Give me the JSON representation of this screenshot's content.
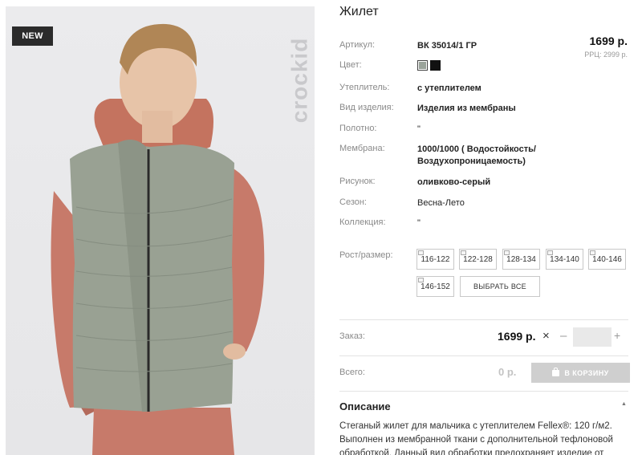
{
  "photo": {
    "badge": "NEW",
    "brand_watermark": "crockid"
  },
  "product": {
    "title": "Жилет",
    "price": "1699 р.",
    "rrp": "РРЦ: 2999 р."
  },
  "attributes": [
    {
      "label": "Артикул:",
      "value": "ВК 35014/1 ГР"
    },
    {
      "label": "Цвет:",
      "value": ""
    },
    {
      "label": "Утеплитель:",
      "value": "с утеплителем"
    },
    {
      "label": "Вид изделия:",
      "value": "Изделия из мембраны"
    },
    {
      "label": "Полотно:",
      "value": "\""
    },
    {
      "label": "Мембрана:",
      "value": "1000/1000 ( Водостойкость/ Воздухопроницаемость)"
    },
    {
      "label": "Рисунок:",
      "value": "оливково-серый"
    },
    {
      "label": "Сезон:",
      "value": "Весна-Лето"
    },
    {
      "label": "Коллекция:",
      "value": "\""
    },
    {
      "label": "Рост/размер:",
      "value": ""
    }
  ],
  "colors": [
    {
      "name": "olive-gray",
      "hex": "#9aa39a",
      "selected": true
    },
    {
      "name": "black",
      "hex": "#111111",
      "selected": false
    }
  ],
  "sizes": [
    "116-122",
    "122-128",
    "128-134",
    "134-140",
    "140-146",
    "146-152"
  ],
  "select_all_label": "ВЫБРАТЬ ВСЕ",
  "order": {
    "label": "Заказ:",
    "price": "1699 р.",
    "remove_symbol": "×",
    "minus": "–",
    "plus": "+",
    "quantity": ""
  },
  "total": {
    "label": "Всего:",
    "price": "0 р.",
    "cart_button": "В КОРЗИНУ"
  },
  "description": {
    "title": "Описание",
    "toggle": "▲",
    "text": "Стеганый жилет для мальчика с утеплителем Fellex®: 120 г/м2. Выполнен из мембранной ткани с дополнительной тефлоновой обработкой. Данный вид обработки предохраняет изделие от"
  }
}
